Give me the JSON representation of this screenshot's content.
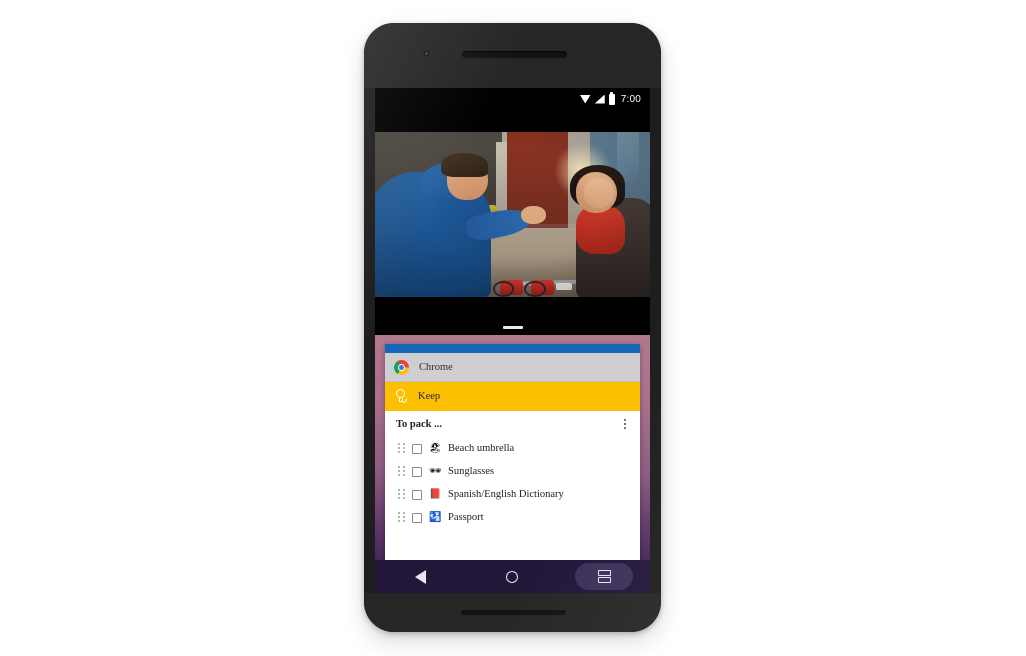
{
  "device": {
    "name": "android-phone",
    "camera": "front-camera",
    "earpiece": "earpiece-speaker",
    "bottom_speaker": "bottom-speaker"
  },
  "status_bar": {
    "time": "7:00",
    "icons": [
      "wifi-icon",
      "signal-icon",
      "battery-icon"
    ]
  },
  "split_screen": {
    "divider": "split-screen-divider-handle",
    "top_pane": {
      "name": "video-pane",
      "content": "video-still-street-scene-man-blue-jacket-woman-red-scarf-bicycles"
    },
    "bottom_pane": {
      "name": "keep-app-pane",
      "background_color": "#a96f8c"
    }
  },
  "app_card": {
    "chrome_bar_color": "#1567b8",
    "rows": [
      {
        "label": "Chrome",
        "icon": "chrome-logo-icon",
        "background": "#cfcfd1"
      },
      {
        "label": "Keep",
        "icon": "keep-bulb-icon",
        "background": "#fcc000"
      }
    ]
  },
  "note": {
    "title": "To pack ...",
    "overflow_menu": "more-options-icon",
    "items": [
      {
        "emoji": "🏖",
        "text": "Beach umbrella",
        "checked": false
      },
      {
        "emoji": "🕶",
        "text": "Sunglasses",
        "checked": false
      },
      {
        "emoji": "📕",
        "text": "Spanish/English Dictionary",
        "checked": false
      },
      {
        "emoji": "🛂",
        "text": "Passport",
        "checked": false
      }
    ]
  },
  "navigation_bar": {
    "background": "#221739",
    "buttons": [
      {
        "name": "back-button",
        "icon": "back-triangle-icon"
      },
      {
        "name": "home-button",
        "icon": "home-circle-icon"
      },
      {
        "name": "recents-split-screen-button",
        "icon": "split-screen-icon",
        "highlighted": true
      }
    ]
  }
}
